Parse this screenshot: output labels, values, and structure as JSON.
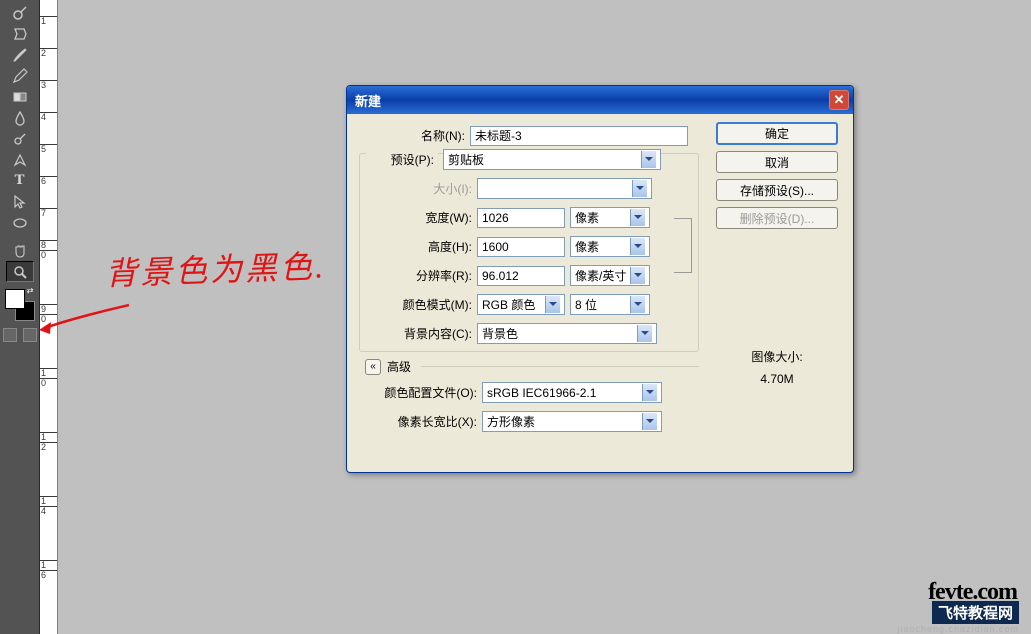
{
  "ruler": {
    "marks": [
      "1",
      "2",
      "3",
      "4",
      "5",
      "6",
      "7",
      "8",
      "0",
      "9",
      "0",
      "1",
      "0",
      "1",
      "2",
      "1",
      "4",
      "1",
      "6"
    ]
  },
  "annotation": {
    "text": "背景色为黑色."
  },
  "dialog": {
    "title": "新建",
    "buttons": {
      "ok": "确定",
      "cancel": "取消",
      "save_preset": "存储预设(S)...",
      "delete_preset": "删除预设(D)..."
    },
    "fields": {
      "name_label": "名称(N):",
      "name_value": "未标题-3",
      "preset_label": "预设(P):",
      "preset_value": "剪贴板",
      "size_label": "大小(I):",
      "size_value": "",
      "width_label": "宽度(W):",
      "width_value": "1026",
      "width_unit": "像素",
      "height_label": "高度(H):",
      "height_value": "1600",
      "height_unit": "像素",
      "resolution_label": "分辨率(R):",
      "resolution_value": "96.012",
      "resolution_unit": "像素/英寸",
      "color_mode_label": "颜色模式(M):",
      "color_mode_value": "RGB 颜色",
      "color_depth": "8 位",
      "bg_label": "背景内容(C):",
      "bg_value": "背景色",
      "advanced_label": "高级",
      "profile_label": "颜色配置文件(O):",
      "profile_value": "sRGB IEC61966-2.1",
      "aspect_label": "像素长宽比(X):",
      "aspect_value": "方形像素"
    },
    "info": {
      "size_label": "图像大小:",
      "size_value": "4.70M"
    }
  },
  "watermark": {
    "brand": "fevte.com",
    "site": "飞特教程网",
    "url": "jiaocheng.chazidian.com"
  }
}
